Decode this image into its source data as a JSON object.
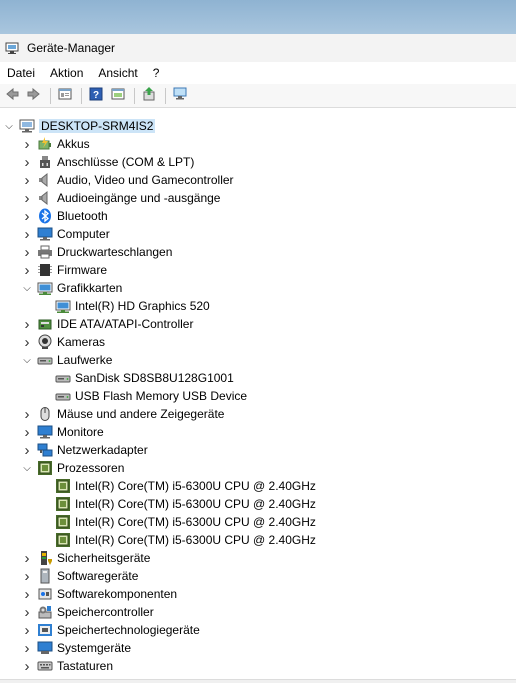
{
  "window": {
    "title": "Geräte-Manager"
  },
  "menu": [
    "Datei",
    "Aktion",
    "Ansicht",
    "?"
  ],
  "toolbar": [
    {
      "name": "back-icon"
    },
    {
      "name": "forward-icon"
    },
    {
      "sep": true
    },
    {
      "name": "properties-icon"
    },
    {
      "sep": true
    },
    {
      "name": "help-icon"
    },
    {
      "name": "show-hidden-icon"
    },
    {
      "sep": true
    },
    {
      "name": "update-driver-icon"
    },
    {
      "sep": true
    },
    {
      "name": "scan-hardware-icon"
    }
  ],
  "tree": [
    {
      "label": "DESKTOP-SRM4IS2",
      "level": 0,
      "state": "open",
      "icon": "computer-root-icon",
      "root": true
    },
    {
      "label": "Akkus",
      "level": 1,
      "state": "closed",
      "icon": "battery-icon"
    },
    {
      "label": "Anschlüsse (COM & LPT)",
      "level": 1,
      "state": "closed",
      "icon": "port-icon"
    },
    {
      "label": "Audio, Video und Gamecontroller",
      "level": 1,
      "state": "closed",
      "icon": "speaker-icon"
    },
    {
      "label": "Audioeingänge und -ausgänge",
      "level": 1,
      "state": "closed",
      "icon": "speaker-icon"
    },
    {
      "label": "Bluetooth",
      "level": 1,
      "state": "closed",
      "icon": "bluetooth-icon"
    },
    {
      "label": "Computer",
      "level": 1,
      "state": "closed",
      "icon": "monitor-icon"
    },
    {
      "label": "Druckwarteschlangen",
      "level": 1,
      "state": "closed",
      "icon": "printer-icon"
    },
    {
      "label": "Firmware",
      "level": 1,
      "state": "closed",
      "icon": "firmware-icon"
    },
    {
      "label": "Grafikkarten",
      "level": 1,
      "state": "open",
      "icon": "display-adapter-icon"
    },
    {
      "label": "Intel(R) HD Graphics 520",
      "level": 2,
      "state": "none",
      "icon": "display-adapter-icon"
    },
    {
      "label": "IDE ATA/ATAPI-Controller",
      "level": 1,
      "state": "closed",
      "icon": "ide-controller-icon"
    },
    {
      "label": "Kameras",
      "level": 1,
      "state": "closed",
      "icon": "camera-icon"
    },
    {
      "label": "Laufwerke",
      "level": 1,
      "state": "open",
      "icon": "drive-icon"
    },
    {
      "label": "SanDisk SD8SB8U128G1001",
      "level": 2,
      "state": "none",
      "icon": "drive-icon"
    },
    {
      "label": "USB Flash Memory USB Device",
      "level": 2,
      "state": "none",
      "icon": "drive-icon"
    },
    {
      "label": "Mäuse und andere Zeigegeräte",
      "level": 1,
      "state": "closed",
      "icon": "mouse-icon"
    },
    {
      "label": "Monitore",
      "level": 1,
      "state": "closed",
      "icon": "monitor-icon"
    },
    {
      "label": "Netzwerkadapter",
      "level": 1,
      "state": "closed",
      "icon": "network-icon"
    },
    {
      "label": "Prozessoren",
      "level": 1,
      "state": "open",
      "icon": "cpu-icon"
    },
    {
      "label": "Intel(R) Core(TM) i5-6300U CPU @ 2.40GHz",
      "level": 2,
      "state": "none",
      "icon": "cpu-icon"
    },
    {
      "label": "Intel(R) Core(TM) i5-6300U CPU @ 2.40GHz",
      "level": 2,
      "state": "none",
      "icon": "cpu-icon"
    },
    {
      "label": "Intel(R) Core(TM) i5-6300U CPU @ 2.40GHz",
      "level": 2,
      "state": "none",
      "icon": "cpu-icon"
    },
    {
      "label": "Intel(R) Core(TM) i5-6300U CPU @ 2.40GHz",
      "level": 2,
      "state": "none",
      "icon": "cpu-icon"
    },
    {
      "label": "Sicherheitsgeräte",
      "level": 1,
      "state": "closed",
      "icon": "security-icon"
    },
    {
      "label": "Softwaregeräte",
      "level": 1,
      "state": "closed",
      "icon": "software-device-icon"
    },
    {
      "label": "Softwarekomponenten",
      "level": 1,
      "state": "closed",
      "icon": "software-component-icon"
    },
    {
      "label": "Speichercontroller",
      "level": 1,
      "state": "closed",
      "icon": "storage-controller-icon"
    },
    {
      "label": "Speichertechnologiegeräte",
      "level": 1,
      "state": "closed",
      "icon": "memory-tech-icon"
    },
    {
      "label": "Systemgeräte",
      "level": 1,
      "state": "closed",
      "icon": "system-device-icon"
    },
    {
      "label": "Tastaturen",
      "level": 1,
      "state": "closed",
      "icon": "keyboard-icon"
    }
  ]
}
